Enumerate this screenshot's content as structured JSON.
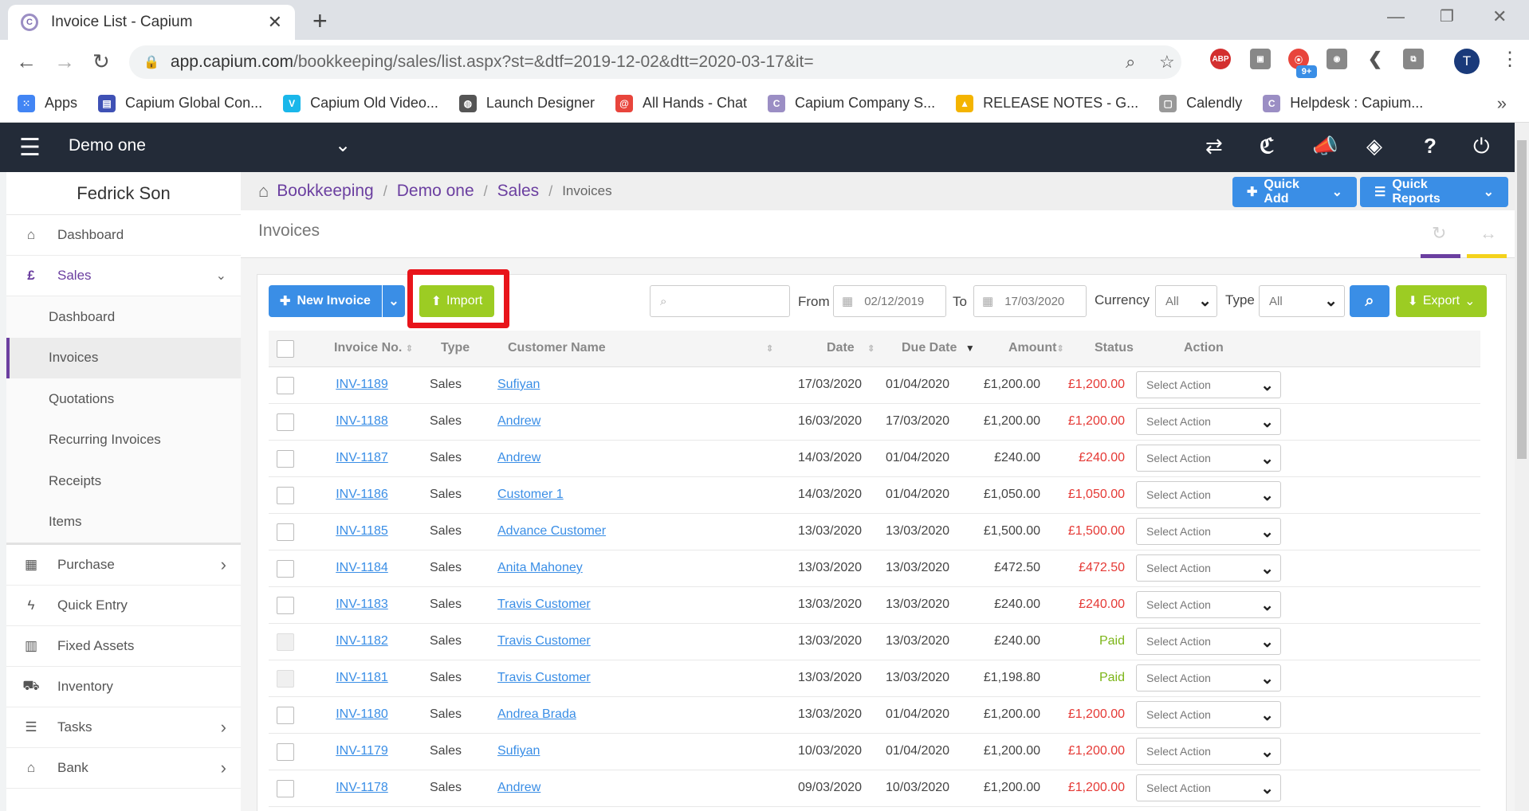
{
  "browser": {
    "tab_title": "Invoice List - Capium",
    "url_host": "app.capium.com",
    "url_path": "/bookkeeping/sales/list.aspx?st=&dtf=2019-12-02&dtt=2020-03-17&it=",
    "avatar_letter": "T",
    "ext_badge": "9+",
    "bookmarks": [
      {
        "label": "Apps",
        "icon": "apps-grid-icon",
        "color": "#4285f4"
      },
      {
        "label": "Capium Global Con...",
        "icon": "capium-icon",
        "color": "#3f51b5"
      },
      {
        "label": "Capium Old Video...",
        "icon": "video-icon",
        "color": "#1ab7ea"
      },
      {
        "label": "Launch Designer",
        "icon": "globe-icon",
        "color": "#555555"
      },
      {
        "label": "All Hands - Chat",
        "icon": "chat-icon",
        "color": "#e8453c"
      },
      {
        "label": "Capium Company S...",
        "icon": "capium-c-icon",
        "color": "#9b8ec4"
      },
      {
        "label": "RELEASE NOTES - G...",
        "icon": "drive-icon",
        "color": "#f4b400"
      },
      {
        "label": "Calendly",
        "icon": "calendar-icon",
        "color": "#999999"
      },
      {
        "label": "Helpdesk : Capium...",
        "icon": "capium-c-icon",
        "color": "#9b8ec4"
      }
    ]
  },
  "header": {
    "company": "Demo one"
  },
  "sidebar": {
    "user": "Fedrick Son",
    "items_top": [
      {
        "label": "Dashboard",
        "icon": "home-icon"
      },
      {
        "label": "Sales",
        "icon": "pound-icon"
      }
    ],
    "sales_sub": [
      "Dashboard",
      "Invoices",
      "Quotations",
      "Recurring Invoices",
      "Receipts",
      "Items"
    ],
    "items_bottom": [
      {
        "label": "Purchase",
        "icon": "grid-icon",
        "chev": true
      },
      {
        "label": "Quick Entry",
        "icon": "bolt-icon",
        "chev": false
      },
      {
        "label": "Fixed Assets",
        "icon": "building-icon",
        "chev": false
      },
      {
        "label": "Inventory",
        "icon": "truck-icon",
        "chev": false
      },
      {
        "label": "Tasks",
        "icon": "tasks-icon",
        "chev": true
      },
      {
        "label": "Bank",
        "icon": "bank-icon",
        "chev": true
      }
    ]
  },
  "breadcrumb": {
    "items": [
      "Bookkeeping",
      "Demo one",
      "Sales"
    ],
    "current": "Invoices"
  },
  "toolbar": {
    "quick_add": "Quick Add",
    "quick_reports": "Quick Reports",
    "page_title": "Invoices",
    "new_invoice": "New Invoice",
    "import": "Import",
    "from_label": "From",
    "from_date": "02/12/2019",
    "to_label": "To",
    "to_date": "17/03/2020",
    "currency_label": "Currency",
    "currency_value": "All",
    "type_label": "Type",
    "type_value": "All",
    "export": "Export"
  },
  "table": {
    "headers": {
      "invoice_no": "Invoice No.",
      "type": "Type",
      "customer": "Customer Name",
      "date": "Date",
      "due_date": "Due Date",
      "amount": "Amount",
      "status": "Status",
      "action": "Action"
    },
    "action_placeholder": "Select Action",
    "rows": [
      {
        "no": "INV-1189",
        "type": "Sales",
        "customer": "Sufiyan",
        "date": "17/03/2020",
        "due": "01/04/2020",
        "amount": "£1,200.00",
        "status": "£1,200.00",
        "paid": false
      },
      {
        "no": "INV-1188",
        "type": "Sales",
        "customer": "Andrew",
        "date": "16/03/2020",
        "due": "17/03/2020",
        "amount": "£1,200.00",
        "status": "£1,200.00",
        "paid": false
      },
      {
        "no": "INV-1187",
        "type": "Sales",
        "customer": "Andrew",
        "date": "14/03/2020",
        "due": "01/04/2020",
        "amount": "£240.00",
        "status": "£240.00",
        "paid": false
      },
      {
        "no": "INV-1186",
        "type": "Sales",
        "customer": "Customer 1",
        "date": "14/03/2020",
        "due": "01/04/2020",
        "amount": "£1,050.00",
        "status": "£1,050.00",
        "paid": false
      },
      {
        "no": "INV-1185",
        "type": "Sales",
        "customer": "Advance Customer",
        "date": "13/03/2020",
        "due": "13/03/2020",
        "amount": "£1,500.00",
        "status": "£1,500.00",
        "paid": false
      },
      {
        "no": "INV-1184",
        "type": "Sales",
        "customer": "Anita Mahoney",
        "date": "13/03/2020",
        "due": "13/03/2020",
        "amount": "£472.50",
        "status": "£472.50",
        "paid": false
      },
      {
        "no": "INV-1183",
        "type": "Sales",
        "customer": "Travis Customer",
        "date": "13/03/2020",
        "due": "13/03/2020",
        "amount": "£240.00",
        "status": "£240.00",
        "paid": false
      },
      {
        "no": "INV-1182",
        "type": "Sales",
        "customer": "Travis Customer",
        "date": "13/03/2020",
        "due": "13/03/2020",
        "amount": "£240.00",
        "status": "Paid",
        "paid": true
      },
      {
        "no": "INV-1181",
        "type": "Sales",
        "customer": "Travis Customer",
        "date": "13/03/2020",
        "due": "13/03/2020",
        "amount": "£1,198.80",
        "status": "Paid",
        "paid": true
      },
      {
        "no": "INV-1180",
        "type": "Sales",
        "customer": "Andrea Brada",
        "date": "13/03/2020",
        "due": "01/04/2020",
        "amount": "£1,200.00",
        "status": "£1,200.00",
        "paid": false
      },
      {
        "no": "INV-1179",
        "type": "Sales",
        "customer": "Sufiyan",
        "date": "10/03/2020",
        "due": "01/04/2020",
        "amount": "£1,200.00",
        "status": "£1,200.00",
        "paid": false
      },
      {
        "no": "INV-1178",
        "type": "Sales",
        "customer": "Andrew",
        "date": "09/03/2020",
        "due": "10/03/2020",
        "amount": "£1,200.00",
        "status": "£1,200.00",
        "paid": false
      }
    ]
  },
  "colors": {
    "accent_purple": "#6b3fa0",
    "header_dark": "#232b38",
    "primary_blue": "#3a8ee6",
    "import_green": "#9ccc23",
    "highlight_red": "#e8141b",
    "due_red": "#e53935",
    "paid_green": "#7cb518"
  }
}
